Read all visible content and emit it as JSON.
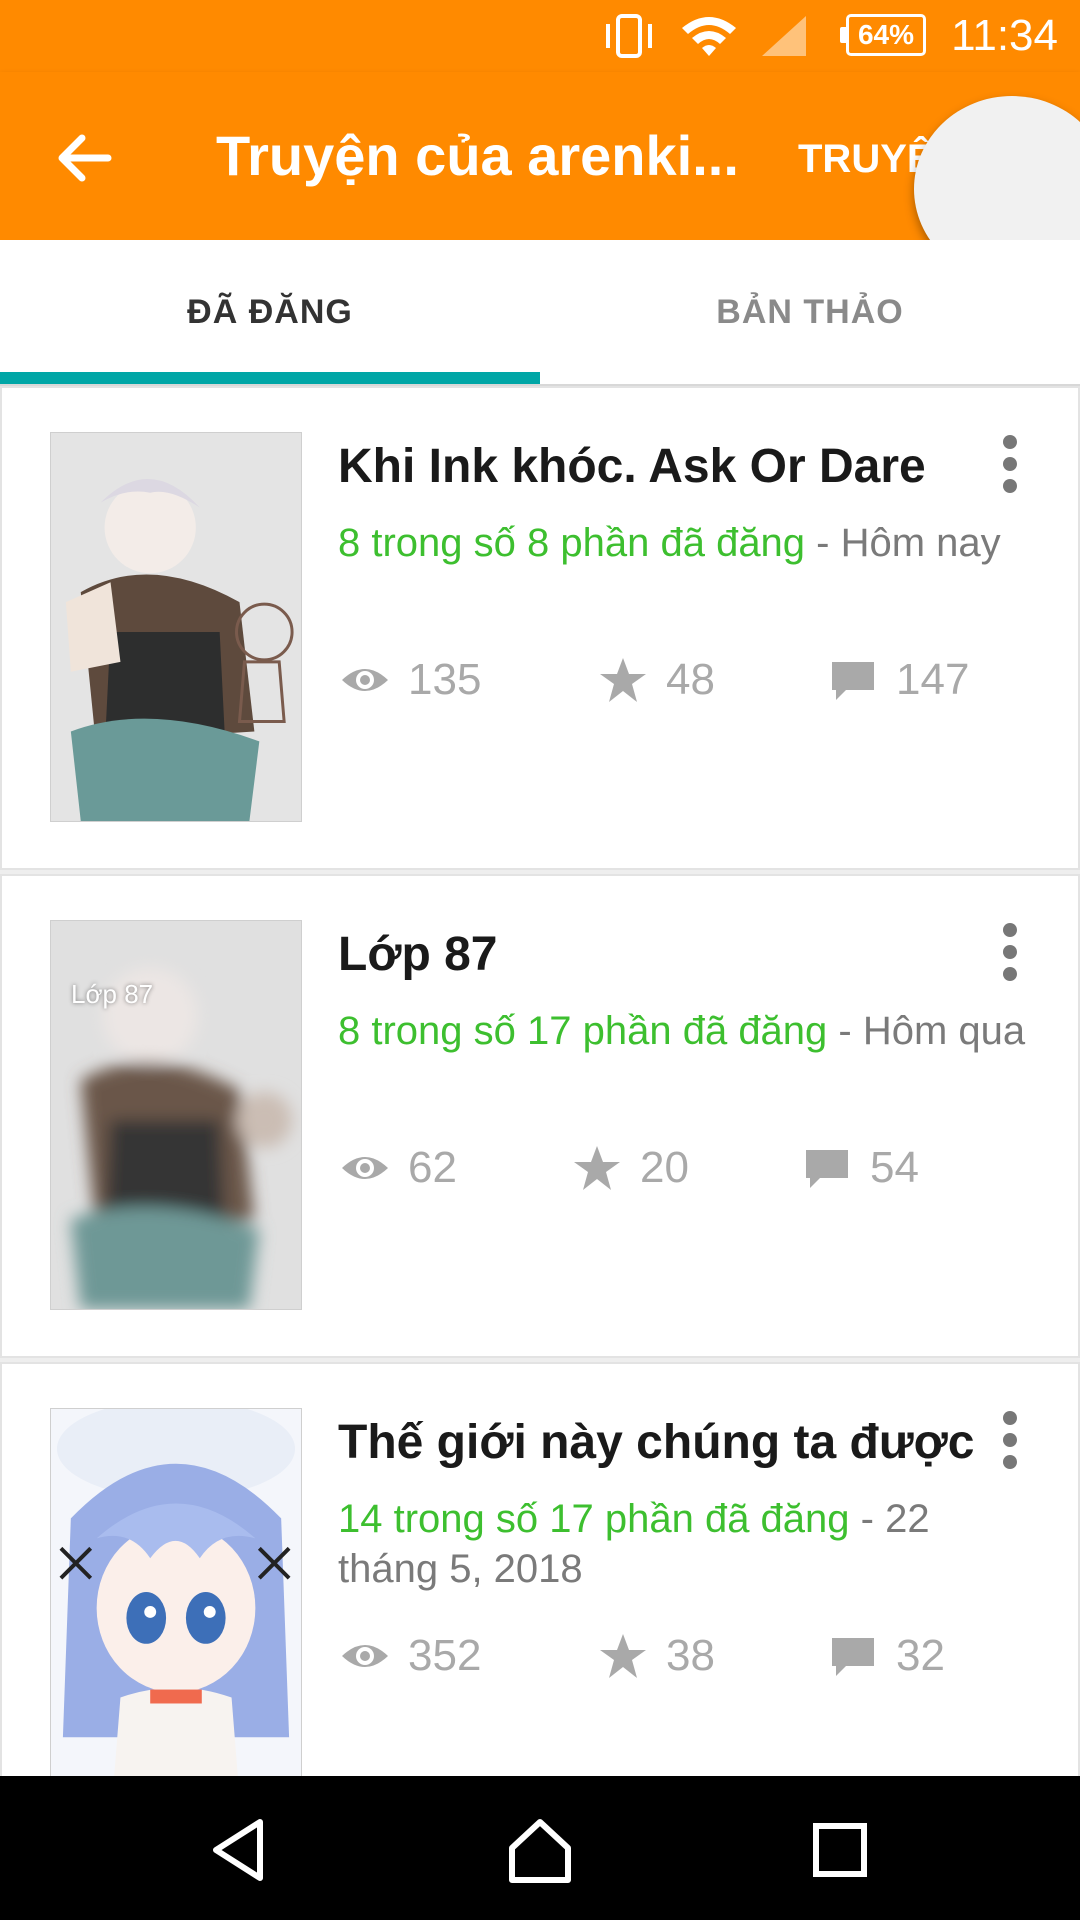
{
  "status_bar": {
    "battery": "64%",
    "time": "11:34",
    "icons": [
      "vibrate-icon",
      "wifi-icon",
      "signal-icon",
      "battery-icon"
    ]
  },
  "app_bar": {
    "title": "Truyện của arenki...",
    "action_label": "TRUYỆ",
    "back_icon": "arrow-left-icon"
  },
  "tabs": [
    {
      "label": "ĐÃ ĐĂNG",
      "selected": true
    },
    {
      "label": "BẢN THẢO",
      "selected": false
    }
  ],
  "stories": [
    {
      "title": "Khi Ink khóc. Ask Or Dare",
      "parts": "8 trong số 8 phần đã đăng",
      "date": " - Hôm nay",
      "views": "135",
      "votes": "48",
      "comments": "147"
    },
    {
      "title": "Lớp 87",
      "cover_caption": "Lớp 87",
      "parts": "8 trong số 17 phần đã đăng",
      "date": " - Hôm qua",
      "views": "62",
      "votes": "20",
      "comments": "54"
    },
    {
      "title": "Thế giới này chúng ta được",
      "parts": "14 trong số 17 phần đã đăng",
      "date": " - 22 tháng 5, 2018",
      "views": "352",
      "votes": "38",
      "comments": "32"
    }
  ],
  "colors": {
    "app_bar": "#ff8a00",
    "tab_indicator": "#00a6a6",
    "published_parts": "#3dbf2f",
    "stat_gray": "#a9a9a9"
  }
}
